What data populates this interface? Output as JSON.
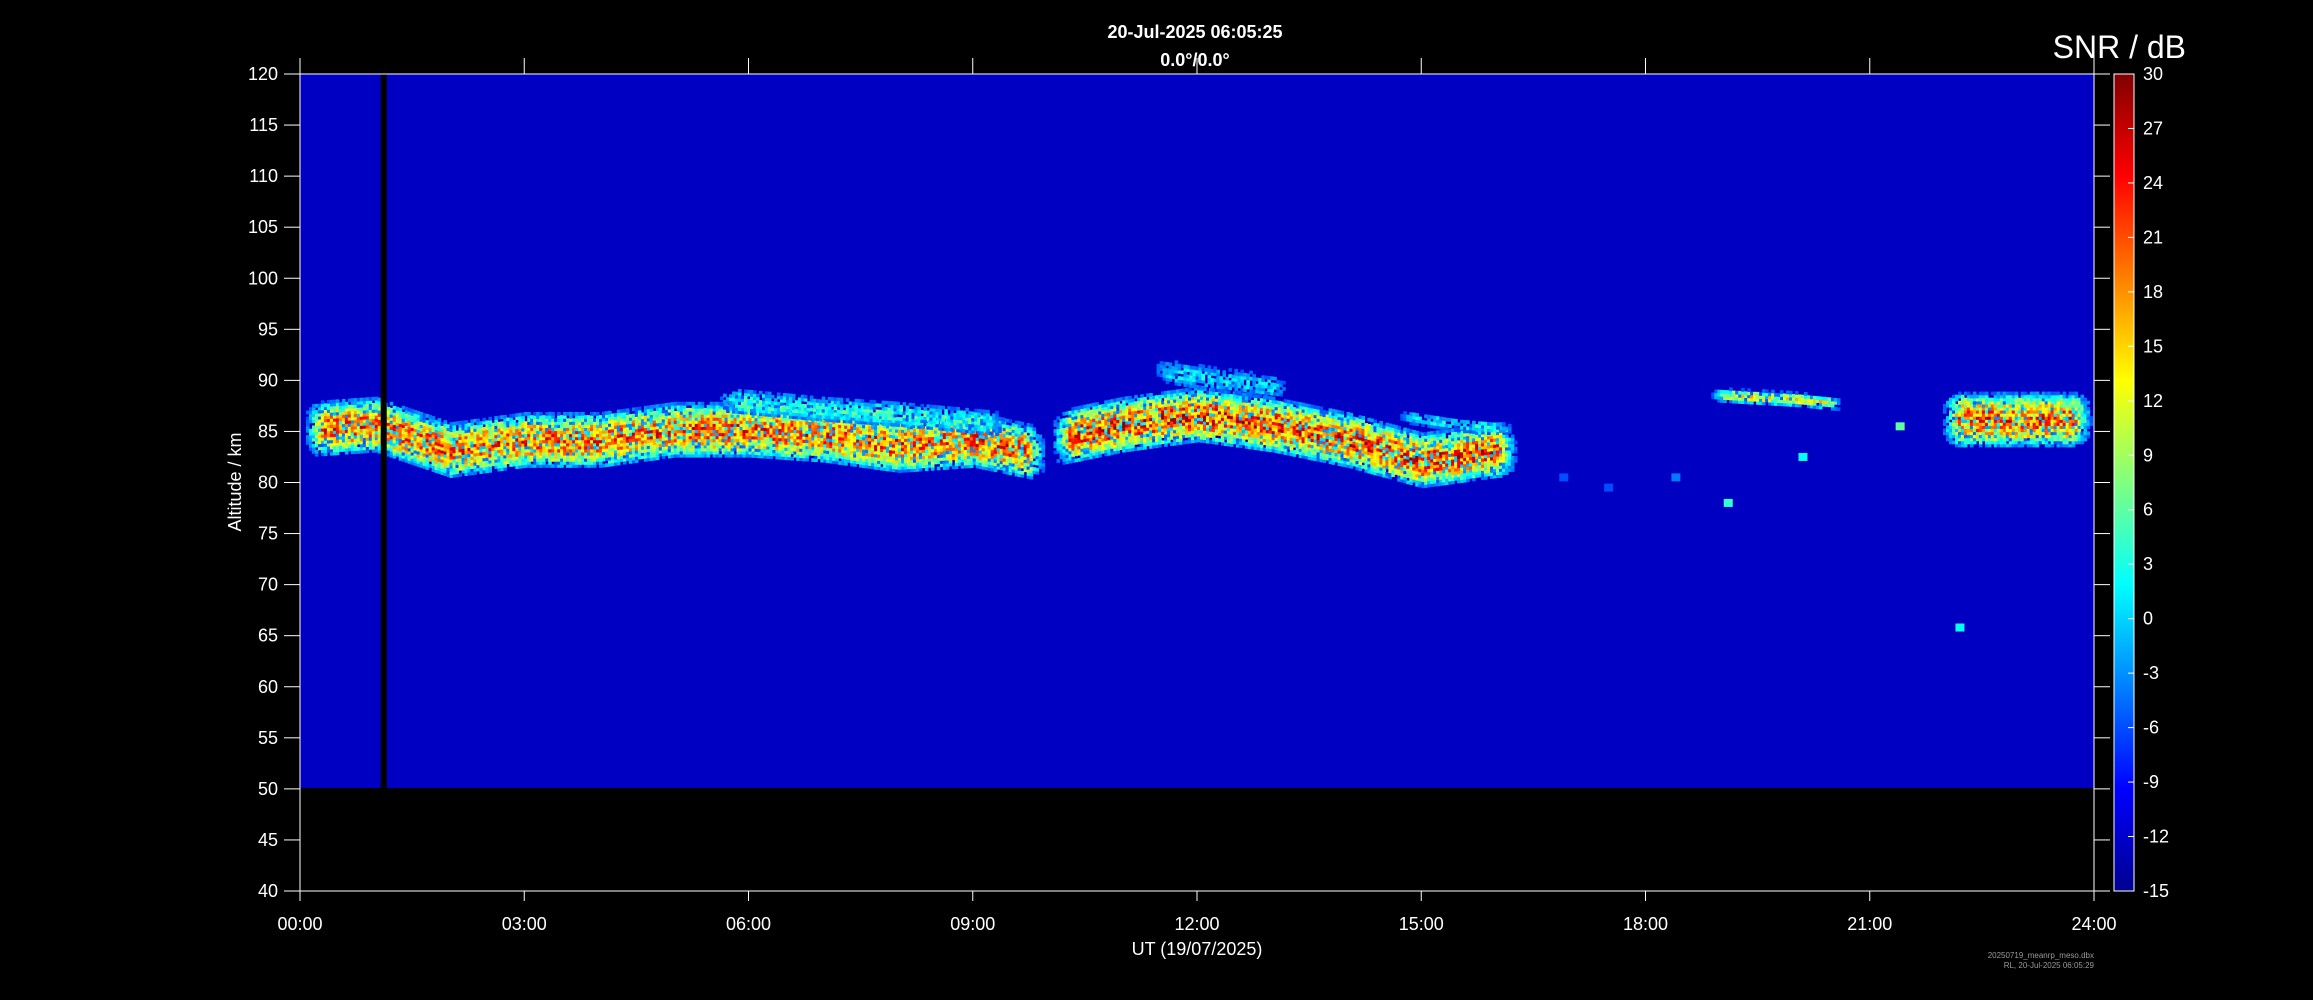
{
  "chart_data": {
    "type": "heatmap",
    "title": "20-Jul-2025 06:05:25",
    "subtitle": "0.0°/0.0°",
    "xlabel": "UT (19/07/2025)",
    "ylabel": "Altitude / km",
    "x_ticks": [
      "00:00",
      "03:00",
      "06:00",
      "09:00",
      "12:00",
      "15:00",
      "18:00",
      "21:00",
      "24:00"
    ],
    "x_range_hours": [
      0,
      24
    ],
    "ylim": [
      40,
      120
    ],
    "y_ticks": [
      40,
      45,
      50,
      55,
      60,
      65,
      70,
      75,
      80,
      85,
      90,
      95,
      100,
      105,
      110,
      115,
      120
    ],
    "data_altitude_range": [
      50,
      120
    ],
    "background_snr_db": -12,
    "data_gap_hours": [
      1.08,
      1.16
    ],
    "colorbar": {
      "label": "SNR / dB",
      "range": [
        -15,
        30
      ],
      "ticks": [
        30,
        27,
        24,
        21,
        18,
        15,
        12,
        9,
        6,
        3,
        0,
        -3,
        -6,
        -9,
        -12,
        -15
      ],
      "colormap": "jet"
    },
    "layers": [
      {
        "name": "main echo layer",
        "t_start": 0.0,
        "t_end": 10.0,
        "alt_center": [
          [
            0,
            85
          ],
          [
            1,
            85.5
          ],
          [
            2,
            83
          ],
          [
            3,
            84
          ],
          [
            4,
            84
          ],
          [
            5,
            85
          ],
          [
            6,
            85
          ],
          [
            7,
            84.5
          ],
          [
            8,
            83.5
          ],
          [
            9,
            84
          ],
          [
            10,
            82.5
          ]
        ],
        "thickness_km": 6,
        "peak_snr_db": 28
      },
      {
        "name": "upper mid layer",
        "t_start": 5.5,
        "t_end": 9.5,
        "alt_center": [
          [
            5.5,
            88
          ],
          [
            7,
            87
          ],
          [
            8,
            86.5
          ],
          [
            9.5,
            85.5
          ]
        ],
        "thickness_km": 3,
        "peak_snr_db": 8
      },
      {
        "name": "noon layer",
        "t_start": 10.0,
        "t_end": 16.3,
        "alt_center": [
          [
            10,
            84
          ],
          [
            11,
            85.5
          ],
          [
            12,
            86.5
          ],
          [
            13,
            85.5
          ],
          [
            14,
            84
          ],
          [
            15,
            82
          ],
          [
            16,
            83
          ]
        ],
        "thickness_km": 6,
        "peak_snr_db": 30
      },
      {
        "name": "noon upper plume",
        "t_start": 11.3,
        "t_end": 13.3,
        "alt_center": [
          [
            11.3,
            91
          ],
          [
            12.2,
            90
          ],
          [
            13.3,
            89
          ]
        ],
        "thickness_km": 3,
        "peak_snr_db": 4
      },
      {
        "name": "secondary layer",
        "t_start": 14.6,
        "t_end": 16.3,
        "alt_center": [
          [
            14.6,
            86.5
          ],
          [
            15.5,
            85.5
          ],
          [
            16.3,
            85
          ]
        ],
        "thickness_km": 1.5,
        "peak_snr_db": 6
      },
      {
        "name": "evening patch",
        "t_start": 18.8,
        "t_end": 20.7,
        "alt_center": [
          [
            18.8,
            88.5
          ],
          [
            20,
            88
          ],
          [
            20.7,
            87.5
          ]
        ],
        "thickness_km": 1.5,
        "peak_snr_db": 18
      },
      {
        "name": "late layer",
        "t_start": 21.9,
        "t_end": 24.0,
        "alt_center": [
          [
            21.9,
            86
          ],
          [
            23,
            86
          ],
          [
            24,
            86
          ]
        ],
        "thickness_km": 6,
        "peak_snr_db": 28
      }
    ],
    "sparse_echoes": [
      {
        "t": 21.4,
        "alt": 85.5,
        "snr_db": 6
      },
      {
        "t": 20.1,
        "alt": 82.5,
        "snr_db": 2
      },
      {
        "t": 19.1,
        "alt": 78,
        "snr_db": 4
      },
      {
        "t": 18.4,
        "alt": 80.5,
        "snr_db": -4
      },
      {
        "t": 17.5,
        "alt": 79.5,
        "snr_db": -6
      },
      {
        "t": 16.9,
        "alt": 80.5,
        "snr_db": -6
      },
      {
        "t": 22.2,
        "alt": 65.8,
        "snr_db": 2
      }
    ]
  },
  "footer": {
    "line1": "20250719_meanrp_meso.dbx",
    "line2": "RL, 20-Jul-2025 06:05:29"
  }
}
